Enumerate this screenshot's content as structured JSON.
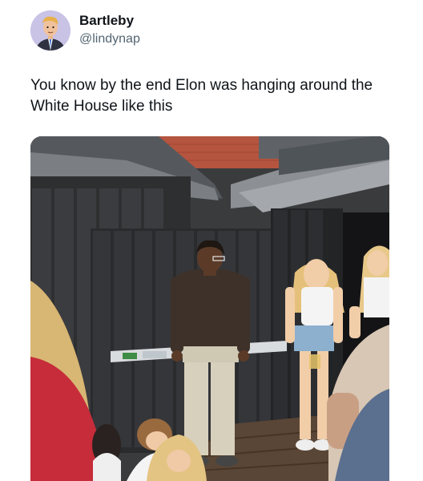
{
  "author": {
    "display_name": "Bartleby",
    "handle": "@lindynap",
    "avatar_icon": "cartoon-man-suit-avatar"
  },
  "tweet": {
    "text": "You know by the end Elon was hanging around the White House like this"
  },
  "media": {
    "icon": "photo-image",
    "colors": {
      "fence": "#2e2f31",
      "brick": "#b5553f",
      "roof": "#8c8f93",
      "deck": "#5a4636"
    }
  }
}
